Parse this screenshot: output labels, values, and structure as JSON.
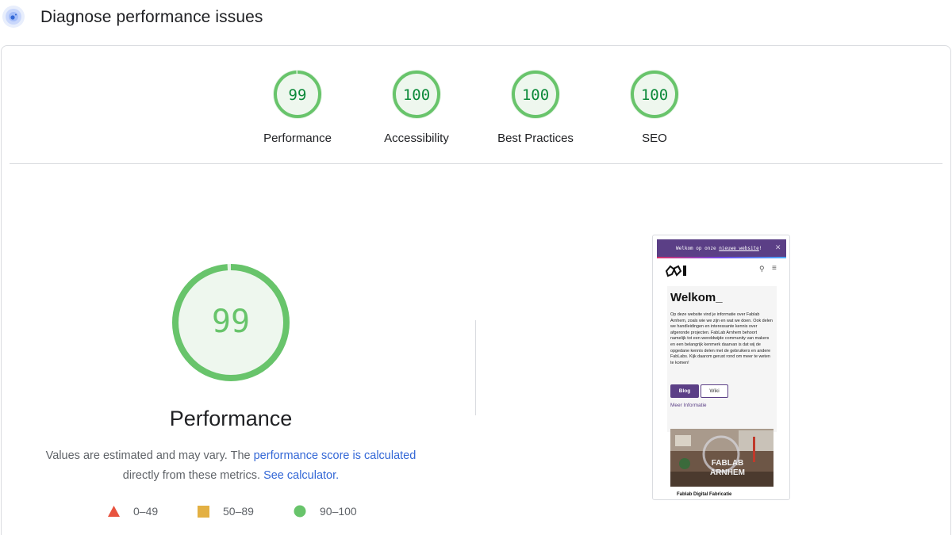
{
  "header": {
    "title": "Diagnose performance issues",
    "icon": "lighthouse-icon"
  },
  "scores": [
    {
      "label": "Performance",
      "score": 99,
      "color": "#0c9d4a",
      "fill": "#68c46b"
    },
    {
      "label": "Accessibility",
      "score": 100,
      "color": "#0c9d4a",
      "fill": "#68c46b"
    },
    {
      "label": "Best Practices",
      "score": 100,
      "color": "#0c9d4a",
      "fill": "#68c46b"
    },
    {
      "label": "SEO",
      "score": 100,
      "color": "#0c9d4a",
      "fill": "#68c46b"
    }
  ],
  "main_gauge": {
    "score": 99,
    "title": "Performance"
  },
  "note": {
    "text_1": "Values are estimated and may vary. The ",
    "link_1": "performance score is calculated",
    "text_2": "directly from these metrics. ",
    "link_2": "See calculator."
  },
  "legend": [
    {
      "range": "0–49",
      "shape": "triangle-icon",
      "color": "#e8533f"
    },
    {
      "range": "50–89",
      "shape": "square-icon",
      "color": "#e3b043"
    },
    {
      "range": "90–100",
      "shape": "circle-icon",
      "color": "#68c46b"
    }
  ],
  "screenshot": {
    "banner_text": "Welkom op onze ",
    "banner_link": "nieuwe website",
    "banner_suffix": "!",
    "heading": "Welkom_",
    "body": "Op deze website vind je informatie over Fablab Arnhem, zoals wie we zijn en wat we doen. Ook delen we handleidingen en interessante kennis over afgeronde projecten. FabLab Arnhem behoort namelijk tot een wereldwijde community van makers en een belangrijk kenmerk daarvan is dat wij de opgedane kennis delen met de gebruikers en andere FabLabs. Kijk daarom gerust rond om meer te weten te komen!",
    "btn_blog": "Blog",
    "btn_wiki": "Wiki",
    "more_link": "Meer Informatie",
    "image_text_1": "FABLAB",
    "image_text_2": "ARNHEM",
    "caption": "Fablab Digital Fabricatie"
  }
}
